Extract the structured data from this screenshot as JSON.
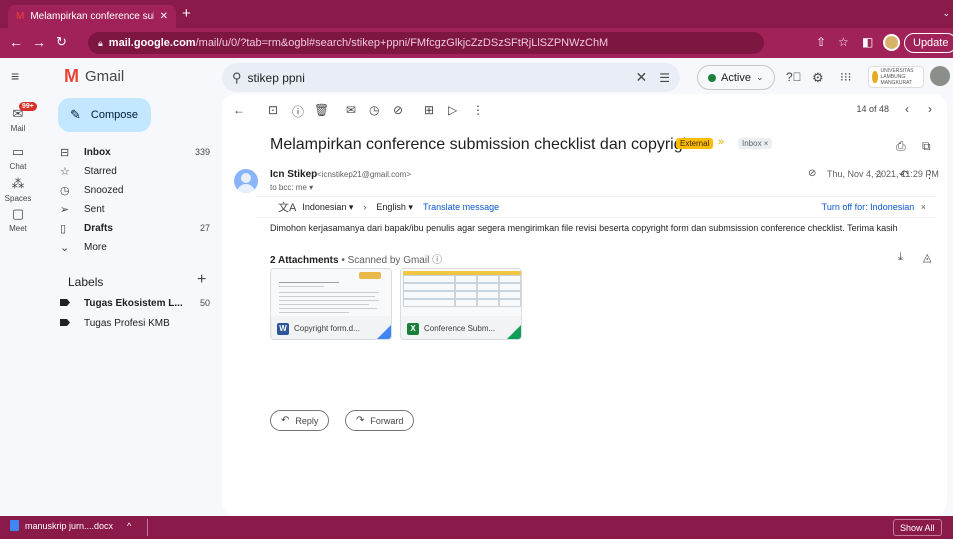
{
  "browser": {
    "tab_title": "Melampirkan conference subm",
    "new_tab": "+",
    "url_host": "mail.google.com",
    "url_path": "/mail/u/0/?tab=rm&ogbl#search/stikep+ppni/FMfcgzGlkjcZzDSzSFtRjLlSZPNWzChM",
    "update_label": "Update"
  },
  "gmail": {
    "logo_text": "Gmail",
    "search_query": "stikep ppni",
    "status_label": "Active",
    "rail": {
      "mail": "Mail",
      "mail_badge": "99+",
      "chat": "Chat",
      "spaces": "Spaces",
      "meet": "Meet"
    },
    "compose_label": "Compose",
    "nav_items": [
      {
        "label": "Inbox",
        "count": "339",
        "bold": true
      },
      {
        "label": "Starred",
        "count": "",
        "bold": false
      },
      {
        "label": "Snoozed",
        "count": "",
        "bold": false
      },
      {
        "label": "Sent",
        "count": "",
        "bold": false
      },
      {
        "label": "Drafts",
        "count": "27",
        "bold": true
      },
      {
        "label": "More",
        "count": "",
        "bold": false
      }
    ],
    "labels_heading": "Labels",
    "labels": [
      {
        "label": "Tugas Ekosistem L...",
        "count": "50",
        "bold": true
      },
      {
        "label": "Tugas Profesi KMB",
        "count": "",
        "bold": false
      }
    ],
    "pager": "14 of 48",
    "university_logo_text": "UNIVERSITAS LAMBUNG MANGKURAT"
  },
  "email": {
    "subject": "Melampirkan conference submission checklist dan copyright",
    "external_badge": "External",
    "inbox_chip": "Inbox ×",
    "sender_name": "Icn Stikep",
    "sender_email": "<icnstikep21@gmail.com>",
    "to_line": "to bcc: me ▾",
    "date": "Thu, Nov 4, 2021, 11:29 PM",
    "translate": {
      "from": "Indonesian ▾",
      "to": "English ▾",
      "link": "Translate message",
      "off": "Turn off for: Indonesian",
      "off_close": "×"
    },
    "body": "Dimohon kerjasamanya dari bapak/ibu penulis agar segera mengirimkan file revisi beserta copyright form dan submsission conference checklist. Terima kasih",
    "attachments_count": "2 Attachments",
    "scanned": "• Scanned by Gmail ⓘ",
    "attachments": [
      {
        "name": "Copyright form.d...",
        "type_letter": "W",
        "type_color": "#2b579a",
        "fold_color": "#4285f4"
      },
      {
        "name": "Conference Subm...",
        "type_letter": "X",
        "type_color": "#188038",
        "fold_color": "#0f9d58"
      }
    ],
    "reply_label": "Reply",
    "forward_label": "Forward"
  },
  "downloads": {
    "file": "manuskrip jurn....docx",
    "chevron": "^",
    "show_all": "Show All"
  },
  "colors": {
    "chrome": "#8a1a4a",
    "compose": "#c2e7ff",
    "external": "#fbbc04",
    "link": "#0b57d0"
  }
}
